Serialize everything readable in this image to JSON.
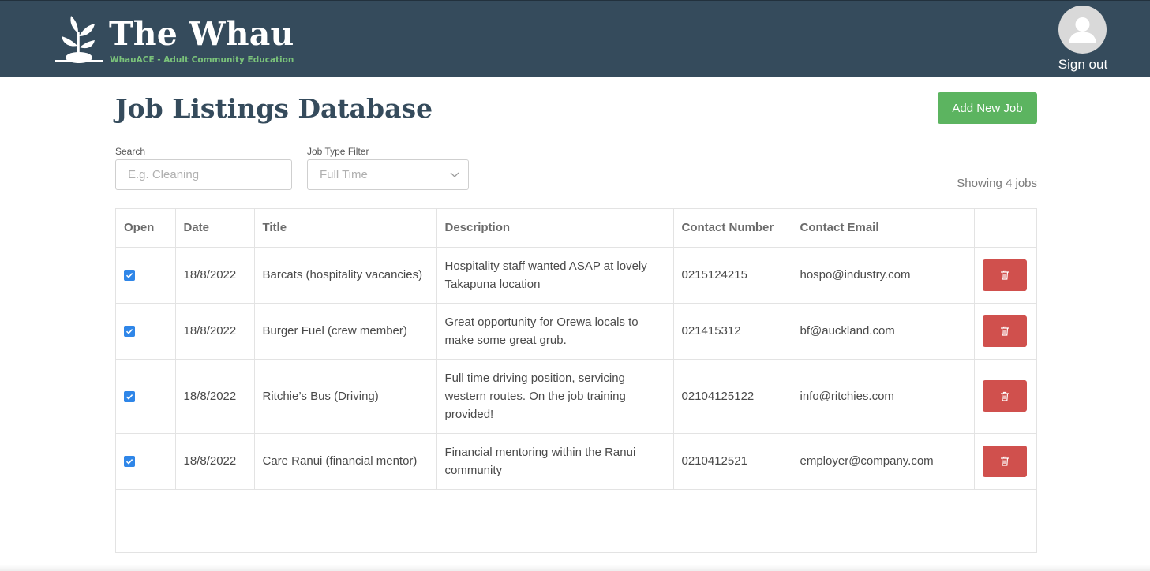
{
  "header": {
    "brand_title": "The Whau",
    "brand_subtitle": "WhauACE - Adult Community Education",
    "sign_out_label": "Sign out",
    "logo_icon": "sprout-icon",
    "avatar_icon": "user-avatar-icon"
  },
  "main": {
    "page_title": "Job Listings Database",
    "add_button_label": "Add New Job",
    "search": {
      "label": "Search",
      "placeholder": "E.g. Cleaning",
      "value": ""
    },
    "filter": {
      "label": "Job Type Filter",
      "selected": "Full Time"
    },
    "showing_text": "Showing 4 jobs"
  },
  "table": {
    "columns": [
      "Open",
      "Date",
      "Title",
      "Description",
      "Contact Number",
      "Contact Email",
      ""
    ],
    "rows": [
      {
        "open": true,
        "date": "18/8/2022",
        "title": "Barcats (hospitality vacancies)",
        "description": "Hospitality staff wanted ASAP at lovely Takapuna location",
        "contact_number": "0215124215",
        "contact_email": "hospo@industry.com"
      },
      {
        "open": true,
        "date": "18/8/2022",
        "title": "Burger Fuel (crew member)",
        "description": "Great opportunity for Orewa locals to make some great grub.",
        "contact_number": "021415312",
        "contact_email": "bf@auckland.com"
      },
      {
        "open": true,
        "date": "18/8/2022",
        "title": "Ritchie’s Bus (Driving)",
        "description": "Full time driving position, servicing western routes. On the job training provided!",
        "contact_number": "02104125122",
        "contact_email": "info@ritchies.com"
      },
      {
        "open": true,
        "date": "18/8/2022",
        "title": "Care Ranui (financial mentor)",
        "description": "Financial mentoring within the Ranui community",
        "contact_number": "0210412521",
        "contact_email": "employer@company.com"
      }
    ]
  },
  "colors": {
    "header_bg": "#354b5c",
    "brand_green": "#7ac27a",
    "add_button": "#5cb460",
    "delete_button": "#d0504d",
    "checkbox": "#2f86e8"
  }
}
